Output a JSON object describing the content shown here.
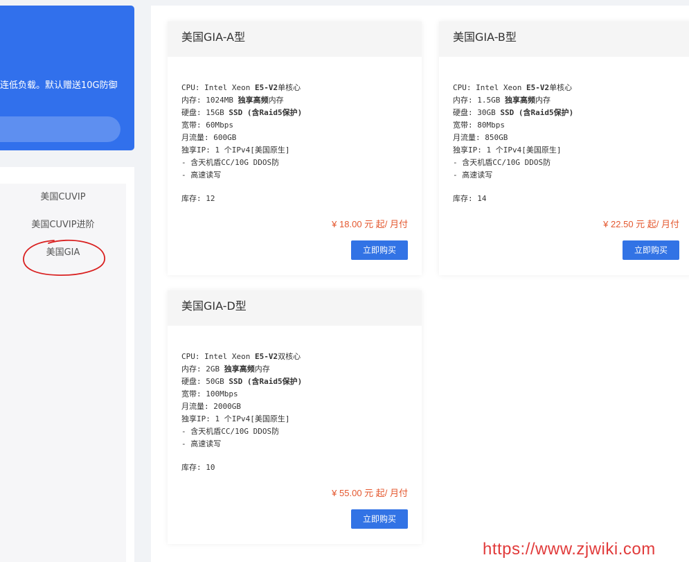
{
  "promo": {
    "text": "连低负载。默认赠送10G防御"
  },
  "categories": [
    {
      "label": "美国CUVIP"
    },
    {
      "label": "美国CUVIP进阶"
    },
    {
      "label": "美国GIA"
    }
  ],
  "products": [
    {
      "title": "美国GIA-A型",
      "cpu_label": "CPU: Intel Xeon ",
      "cpu_bold": "E5-V2",
      "cpu_rest": "单核心",
      "mem_label": "内存: 1024MB ",
      "mem_bold": "独享高频",
      "mem_rest": "内存",
      "disk_label": "硬盘: 15GB ",
      "disk_bold": "SSD (含Raid5保护)",
      "bandwidth": "宽带: 60Mbps",
      "traffic": "月流量: 600GB",
      "ip": "独享IP: 1 个IPv4[美国原生]",
      "feature1": "- 含天机盾CC/10G DDOS防",
      "feature2": "- 高速读写",
      "stock": "库存:  12",
      "price": "¥ 18.00 元 起/ 月付",
      "buy_label": "立即购买"
    },
    {
      "title": "美国GIA-B型",
      "cpu_label": "CPU: Intel Xeon ",
      "cpu_bold": "E5-V2",
      "cpu_rest": "单核心",
      "mem_label": "内存: 1.5GB ",
      "mem_bold": "独享高频",
      "mem_rest": "内存",
      "disk_label": "硬盘: 30GB ",
      "disk_bold": "SSD (含Raid5保护)",
      "bandwidth": "宽带: 80Mbps",
      "traffic": "月流量: 850GB",
      "ip": "独享IP: 1 个IPv4[美国原生]",
      "feature1": "- 含天机盾CC/10G DDOS防",
      "feature2": "- 高速读写",
      "stock": "库存:  14",
      "price": "¥ 22.50 元 起/ 月付",
      "buy_label": "立即购买"
    },
    {
      "title": "美国GIA-D型",
      "cpu_label": "CPU: Intel Xeon ",
      "cpu_bold": "E5-V2",
      "cpu_rest": "双核心",
      "mem_label": "内存: 2GB ",
      "mem_bold": "独享高频",
      "mem_rest": "内存",
      "disk_label": "硬盘: 50GB ",
      "disk_bold": "SSD (含Raid5保护)",
      "bandwidth": "宽带: 100Mbps",
      "traffic": "月流量: 2000GB",
      "ip": "独享IP: 1 个IPv4[美国原生]",
      "feature1": "- 含天机盾CC/10G DDOS防",
      "feature2": "- 高速读写",
      "stock": "库存:  10",
      "price": "¥ 55.00 元 起/ 月付",
      "buy_label": "立即购买"
    }
  ],
  "watermark": "https://www.zjwiki.com",
  "colors": {
    "accent": "#3170ec",
    "price": "#e4572e",
    "annotation": "#d92020",
    "watermark": "#e13b3b"
  }
}
